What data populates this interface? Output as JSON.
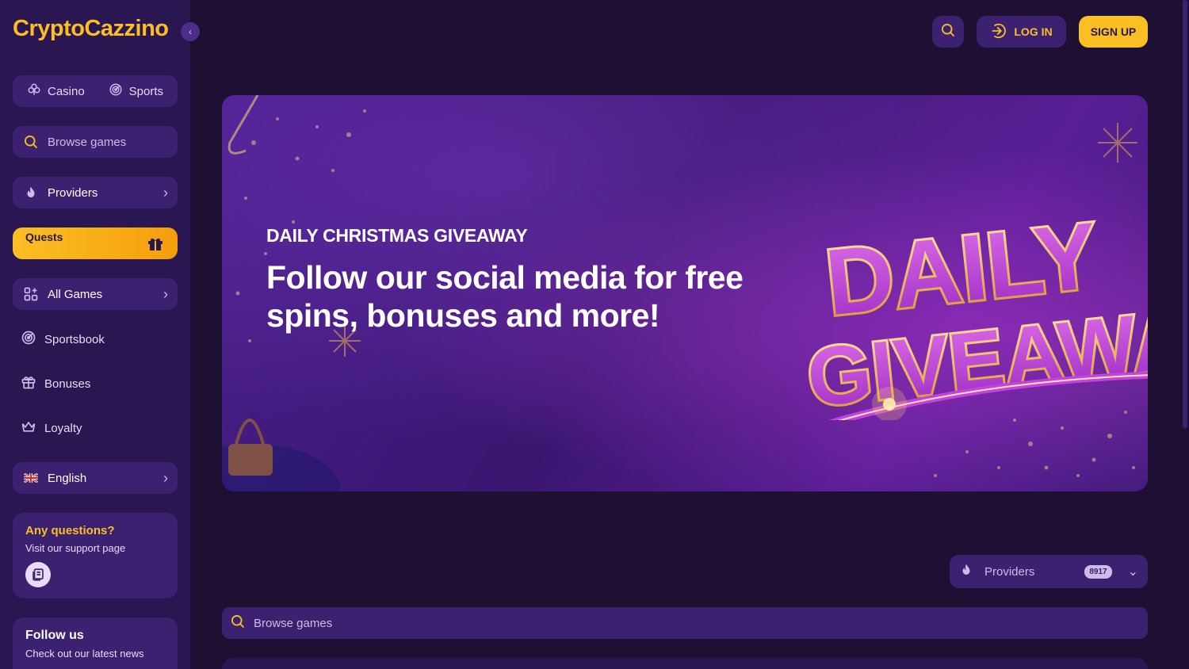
{
  "brand": {
    "logo_text": "CryptoCazzino",
    "accent": "#fbbf24",
    "bg": "#1e1032",
    "panel": "#3b2170"
  },
  "sidebar": {
    "collapse_icon": "chevron-left-icon",
    "tabs": [
      {
        "label": "Casino",
        "icon": "clover-icon"
      },
      {
        "label": "Sports",
        "icon": "target-icon"
      }
    ],
    "search_placeholder": "Browse games",
    "providers_label": "Providers",
    "quests_label": "Quests",
    "all_games_label": "All Games",
    "nav": [
      {
        "label": "Sportsbook",
        "icon": "target-icon"
      },
      {
        "label": "Bonuses",
        "icon": "gift-icon"
      },
      {
        "label": "Loyalty",
        "icon": "crown-icon"
      }
    ],
    "language_label": "English",
    "support_card": {
      "title": "Any questions?",
      "text": "Visit our support page"
    },
    "follow_card": {
      "title": "Follow us",
      "text": "Check out our latest news"
    }
  },
  "header": {
    "search_icon": "search-icon",
    "login_label": "LOG IN",
    "signup_label": "SIGN UP"
  },
  "banner": {
    "kicker": "DAILY CHRISTMAS GIVEAWAY",
    "headline": "Follow our social media for free spins, bonuses and more!",
    "art_line1": "DAILY",
    "art_line2": "GIVEAWAY"
  },
  "filters": {
    "providers_label": "Providers",
    "providers_count": "8917",
    "search_placeholder": "Browse games"
  }
}
